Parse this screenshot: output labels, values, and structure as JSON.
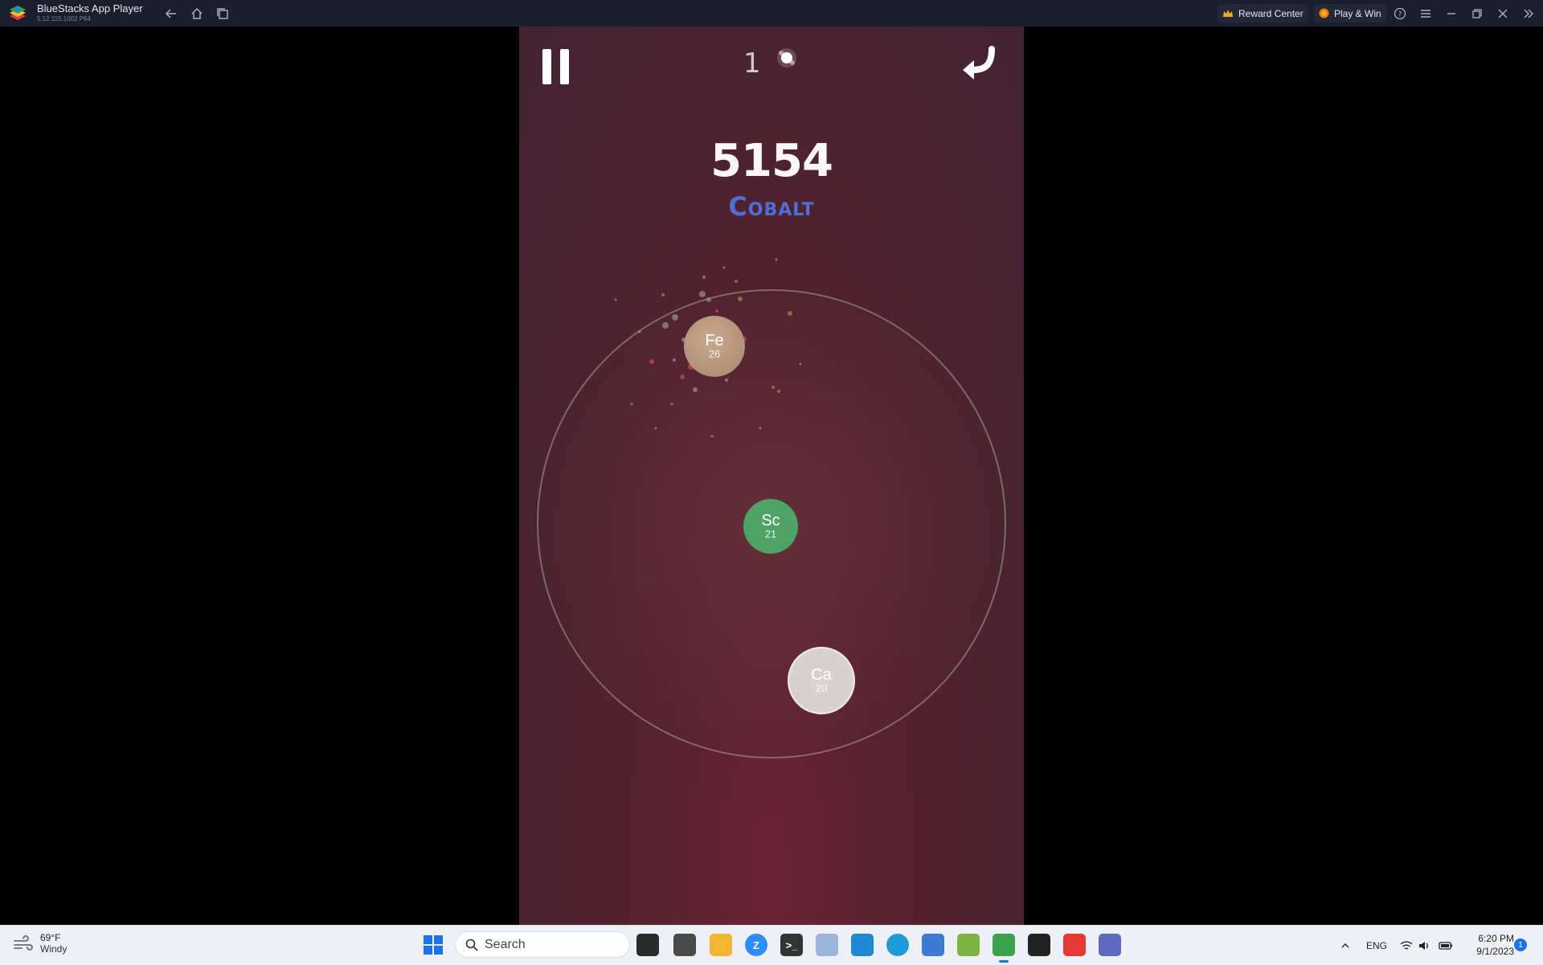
{
  "window": {
    "app_name": "BlueStacks App Player",
    "app_version": "5.12.115.1002 P64",
    "reward_center_label": "Reward Center",
    "play_win_label": "Play & Win"
  },
  "game": {
    "moves_count": "1",
    "score": "5154",
    "element_name": "Cobalt",
    "atoms": [
      {
        "symbol": "Fe",
        "number": "26",
        "color": "#b8967d"
      },
      {
        "symbol": "Sc",
        "number": "21",
        "color": "#4ea467"
      },
      {
        "symbol": "Ca",
        "number": "20",
        "color": "#d9d1d0"
      }
    ]
  },
  "taskbar": {
    "weather_temp": "69°F",
    "weather_condition": "Windy",
    "search_placeholder": "Search",
    "language": "ENG",
    "time": "6:20 PM",
    "date": "9/1/2023",
    "notification_count": "1"
  }
}
